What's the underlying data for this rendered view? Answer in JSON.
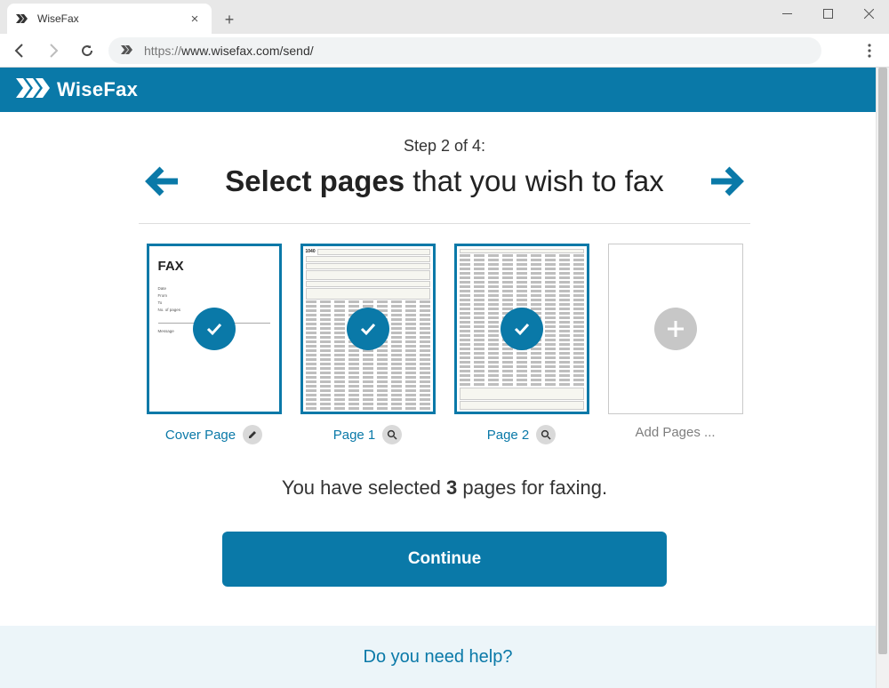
{
  "window": {
    "tab_title": "WiseFax"
  },
  "browser": {
    "url_protocol": "https://",
    "url_rest": "www.wisefax.com/send/"
  },
  "header": {
    "logo_text": "WiseFax"
  },
  "steps": {
    "label": "Step 2 of 4:",
    "heading_bold": "Select pages",
    "heading_rest": " that you wish to fax"
  },
  "thumbs": {
    "cover": {
      "title": "FAX",
      "caption": "Cover Page"
    },
    "page1": {
      "caption": "Page 1"
    },
    "page2": {
      "caption": "Page 2"
    },
    "add": {
      "caption": "Add Pages ..."
    }
  },
  "summary": {
    "prefix": "You have selected ",
    "count": "3",
    "suffix": " pages for faxing."
  },
  "buttons": {
    "continue": "Continue"
  },
  "help": {
    "label": "Do you need help?"
  }
}
